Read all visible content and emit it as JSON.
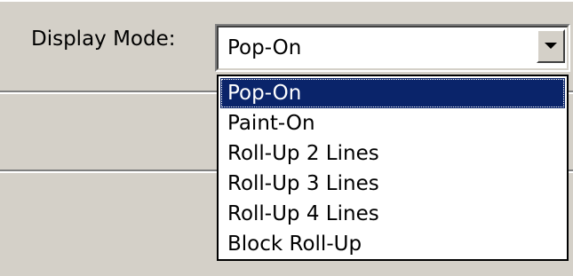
{
  "field": {
    "label": "Display Mode:",
    "current_value": "Pop-On"
  },
  "dropdown": {
    "options": [
      "Pop-On",
      "Paint-On",
      "Roll-Up 2 Lines",
      "Roll-Up 3 Lines",
      "Roll-Up 4 Lines",
      "Block Roll-Up"
    ],
    "selected_index": 0
  },
  "icons": {
    "dropdown_button": "chevron-down-icon"
  },
  "colors": {
    "window_background": "#d4d0c8",
    "selection_background": "#0a246a",
    "selection_text": "#ffffff"
  }
}
